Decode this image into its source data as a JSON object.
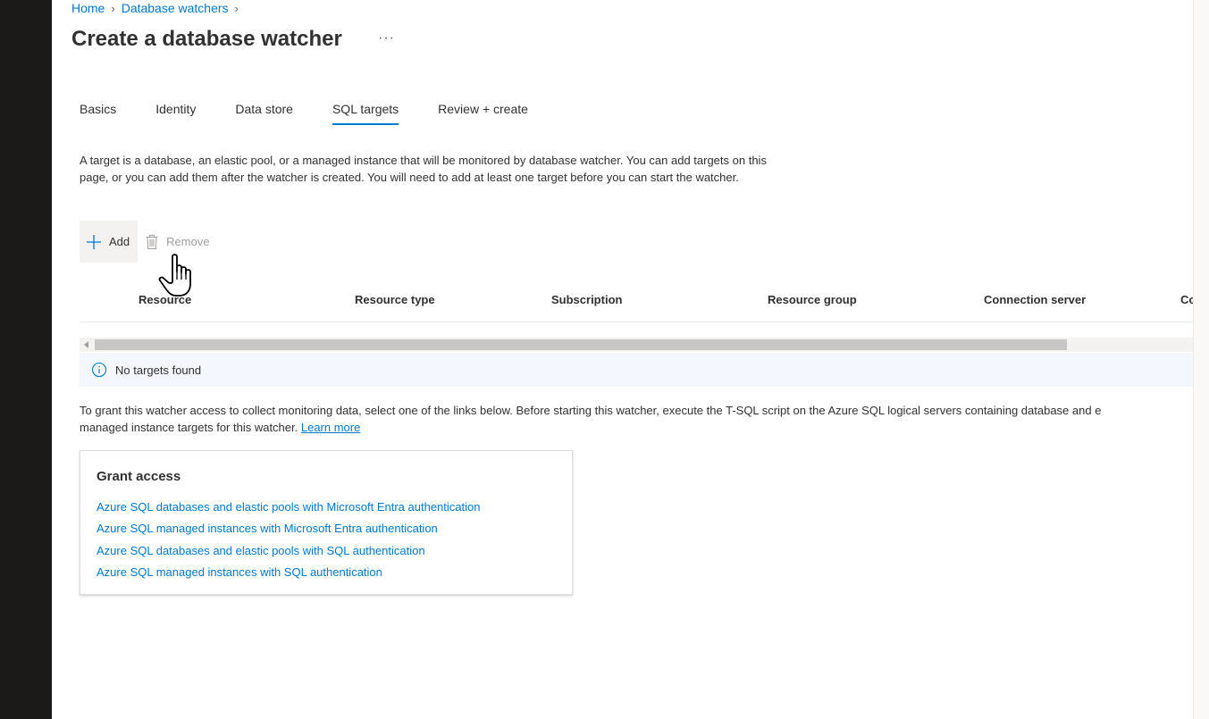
{
  "breadcrumb": {
    "items": [
      "Home",
      "Database watchers"
    ]
  },
  "page": {
    "title": "Create a database watcher",
    "more_label": "···"
  },
  "tabs": [
    {
      "label": "Basics",
      "active": false
    },
    {
      "label": "Identity",
      "active": false
    },
    {
      "label": "Data store",
      "active": false
    },
    {
      "label": "SQL targets",
      "active": true
    },
    {
      "label": "Review + create",
      "active": false
    }
  ],
  "description": "A target is a database, an elastic pool, or a managed instance that will be monitored by database watcher. You can add targets on this page, or you can add them after the watcher is created. You will need to add at least one target before you can start the watcher.",
  "toolbar": {
    "add_label": "Add",
    "remove_label": "Remove"
  },
  "table": {
    "columns": [
      "Resource",
      "Resource type",
      "Subscription",
      "Resource group",
      "Connection server",
      "Co"
    ],
    "empty_message": "No targets found"
  },
  "grant": {
    "text": "To grant this watcher access to collect monitoring data, select one of the links below. Before starting this watcher, execute the T-SQL script on the Azure SQL logical servers containing database and e",
    "text_line2": "managed instance targets for this watcher. ",
    "learn_more": "Learn more",
    "card_title": "Grant access",
    "links": [
      "Azure SQL databases and elastic pools with Microsoft Entra authentication",
      "Azure SQL managed instances with Microsoft Entra authentication",
      "Azure SQL databases and elastic pools with SQL authentication",
      "Azure SQL managed instances with SQL authentication"
    ]
  },
  "colors": {
    "accent": "#0078d4",
    "text": "#323130",
    "dark_strip": "#1b1a19"
  },
  "icons": {
    "more": "more-icon",
    "add": "plus-icon",
    "remove": "trash-icon",
    "info": "info-icon",
    "cursor": "hand-pointer-icon"
  }
}
